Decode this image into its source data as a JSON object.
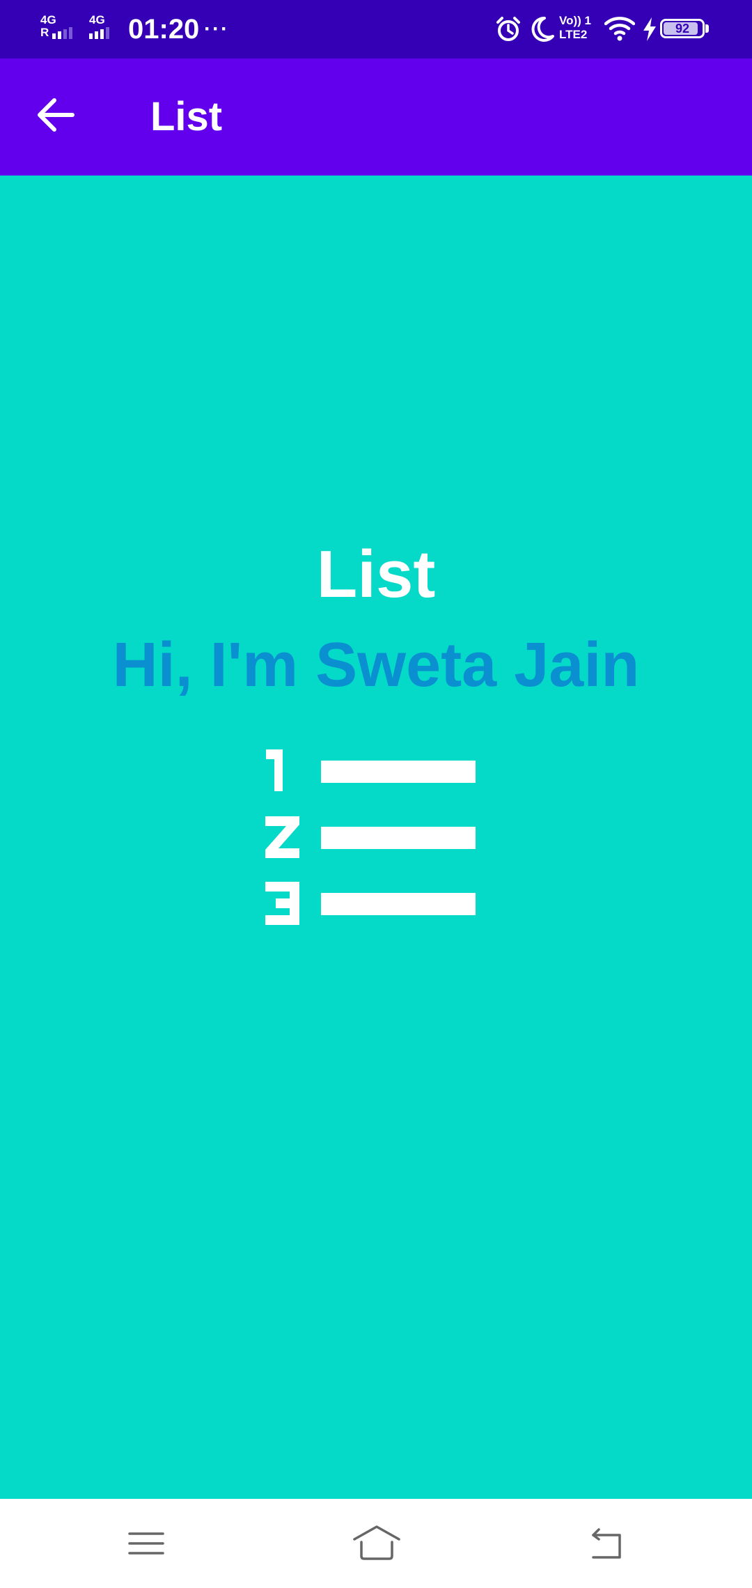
{
  "status_bar": {
    "net1_label": "4G",
    "net1_sub": "R",
    "net2_label": "4G",
    "time": "01:20",
    "more": "···",
    "volte_top": "Vo)) 1",
    "volte_bottom": "LTE2",
    "battery": "92",
    "battery_level": 0.92
  },
  "app_bar": {
    "title": "List",
    "back_icon": "arrow-left-icon",
    "background": "#6200ee"
  },
  "content": {
    "title": "List",
    "subtitle": "Hi, I'm Sweta Jain",
    "icon": "numbered-list-icon",
    "background": "#05d9c8",
    "subtitle_color": "#0a8fd0"
  },
  "nav_bar": {
    "menu_icon": "menu-icon",
    "home_icon": "home-icon",
    "back_icon": "back-icon"
  }
}
